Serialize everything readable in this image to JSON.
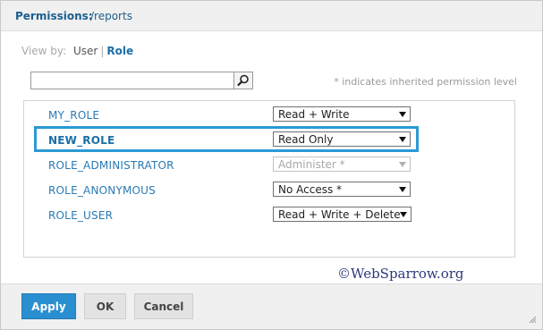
{
  "dialog": {
    "title_label": "Permissions:",
    "title_path": "/reports"
  },
  "view_by": {
    "label": "View by:",
    "user": "User",
    "separator": "|",
    "role": "Role"
  },
  "search": {
    "value": "",
    "placeholder": ""
  },
  "hint": "* indicates inherited permission level",
  "roles": [
    {
      "name": "MY_ROLE",
      "permission": "Read + Write"
    },
    {
      "name": "NEW_ROLE",
      "permission": "Read Only"
    },
    {
      "name": "ROLE_ADMINISTRATOR",
      "permission": "Administer *"
    },
    {
      "name": "ROLE_ANONYMOUS",
      "permission": "No Access *"
    },
    {
      "name": "ROLE_USER",
      "permission": "Read + Write + Delete"
    }
  ],
  "watermark": "©WebSparrow.org",
  "footer": {
    "apply_label": "Apply",
    "ok_label": "OK",
    "cancel_label": "Cancel"
  },
  "colors": {
    "accent": "#2a8fd0",
    "title": "#1b5f8e",
    "role_link": "#2a7ab5",
    "highlight": "#2a9ad4"
  },
  "icons": {
    "search": "search-icon",
    "dropdown": "chevron-down-icon",
    "resize": "resize-grip-icon"
  }
}
